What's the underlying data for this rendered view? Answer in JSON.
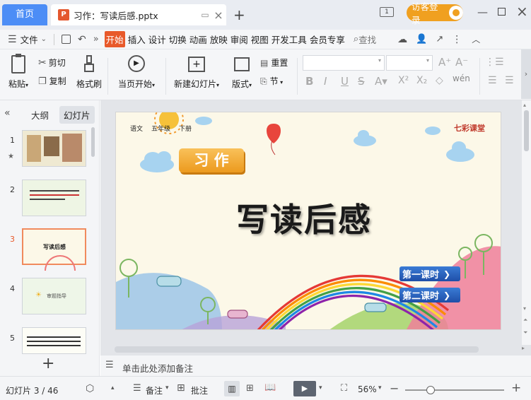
{
  "titlebar": {
    "home_tab": "首页",
    "doc_tab_icon": "P",
    "doc_title": "习作：写读后感.pptx",
    "login_label": "访客登录",
    "window_badge": "1"
  },
  "menu": {
    "file": "文件",
    "items": [
      "开始",
      "插入",
      "设计",
      "切换",
      "动画",
      "放映",
      "审阅",
      "视图",
      "开发工具",
      "会员专享"
    ],
    "search": "查找"
  },
  "ribbon": {
    "paste": "粘贴",
    "cut": "剪切",
    "copy": "复制",
    "format_painter": "格式刷",
    "play_from_current": "当页开始",
    "new_slide": "新建幻灯片",
    "layout": "版式",
    "reset": "重置",
    "section": "节"
  },
  "panel": {
    "tab_outline": "大纲",
    "tab_slides": "幻灯片",
    "slides": [
      {
        "num": "1",
        "label": ""
      },
      {
        "num": "2",
        "label": ""
      },
      {
        "num": "3",
        "label": "写读后感"
      },
      {
        "num": "4",
        "label": "审题指导"
      },
      {
        "num": "5",
        "label": ""
      }
    ],
    "add": "+"
  },
  "slide": {
    "header_tags": [
      "语文",
      "五年级",
      "下册"
    ],
    "brand": "七彩课堂",
    "badge": "习 作",
    "title": "写读后感",
    "lesson1": "第一课时",
    "lesson2": "第二课时"
  },
  "notes_placeholder": "单击此处添加备注",
  "status": {
    "slide_counter": "幻灯片 3 / 46",
    "notes_label": "备注",
    "comments_label": "批注",
    "zoom": "56%"
  }
}
